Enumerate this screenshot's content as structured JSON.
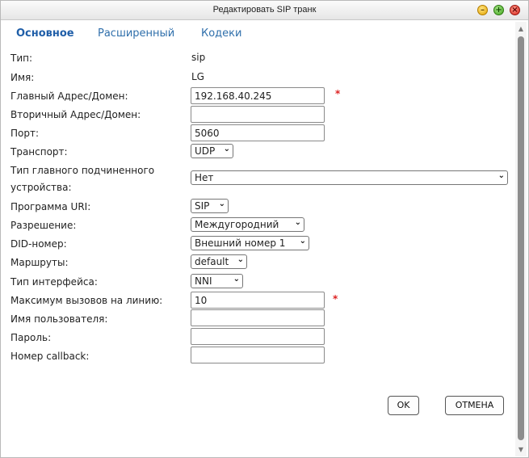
{
  "window": {
    "title": "Редактировать SIP транк",
    "min_glyph": "–",
    "max_glyph": "+",
    "close_glyph": "×"
  },
  "tabs": [
    {
      "label": "Основное",
      "active": true
    },
    {
      "label": "Расширенный",
      "active": false
    },
    {
      "label": "Кодеки",
      "active": false
    }
  ],
  "form": {
    "type_label": "Тип:",
    "type_value": "sip",
    "name_label": "Имя:",
    "name_value": "LG",
    "primary_label": "Главный Адрес/Домен:",
    "primary_value": "192.168.40.245",
    "secondary_label": "Вторичный Адрес/Домен:",
    "secondary_value": "",
    "port_label": "Порт:",
    "port_value": "5060",
    "transport_label": "Транспорт:",
    "transport_value": "UDP",
    "slave_label_line1": "Тип главного подчиненного",
    "slave_label_line2": "устройства:",
    "slave_value": "Нет",
    "uri_label": "Программа URI:",
    "uri_value": "SIP",
    "permission_label": "Разрешение:",
    "permission_value": "Междугородний",
    "did_label": "DID-номер:",
    "did_value": "Внешний номер 1",
    "routes_label": "Маршруты:",
    "routes_value": "default",
    "iface_label": "Тип интерфейса:",
    "iface_value": "NNI",
    "maxcalls_label": "Максимум вызовов на линию:",
    "maxcalls_value": "10",
    "username_label": "Имя пользователя:",
    "username_value": "",
    "password_label": "Пароль:",
    "password_value": "",
    "callback_label": "Номер callback:",
    "callback_value": "",
    "required_mark": "*",
    "chevron": "⌄"
  },
  "buttons": {
    "ok": "OK",
    "cancel": "ОТМЕНА"
  },
  "scrollbar": {
    "up": "▲",
    "down": "▼"
  }
}
